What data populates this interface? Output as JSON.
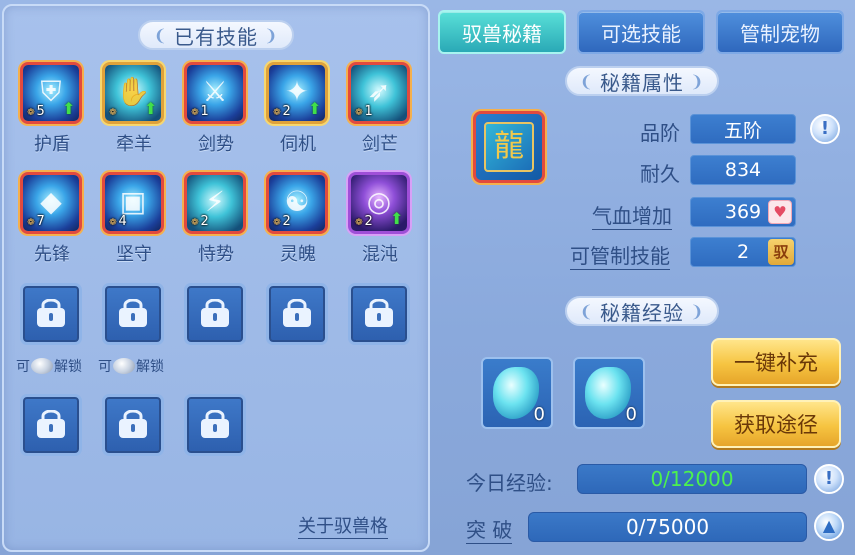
{
  "owned_skills": {
    "title": "已有技能",
    "skills": [
      {
        "name": "护盾",
        "level": "5",
        "upgradable": true,
        "frame": "red",
        "glyph": "⛨"
      },
      {
        "name": "牵羊",
        "level": "",
        "upgradable": true,
        "frame": "gold",
        "glyph": "✋"
      },
      {
        "name": "剑势",
        "level": "1",
        "upgradable": false,
        "frame": "red",
        "glyph": "⚔"
      },
      {
        "name": "伺机",
        "level": "2",
        "upgradable": true,
        "frame": "gold",
        "glyph": "✦"
      },
      {
        "name": "剑芒",
        "level": "1",
        "upgradable": false,
        "frame": "red",
        "glyph": "➶"
      },
      {
        "name": "先锋",
        "level": "7",
        "upgradable": false,
        "frame": "red",
        "glyph": "◆"
      },
      {
        "name": "坚守",
        "level": "4",
        "upgradable": false,
        "frame": "red",
        "glyph": "▣"
      },
      {
        "name": "恃势",
        "level": "2",
        "upgradable": false,
        "frame": "red",
        "glyph": "⚡"
      },
      {
        "name": "灵魄",
        "level": "2",
        "upgradable": false,
        "frame": "red",
        "glyph": "☯"
      },
      {
        "name": "混沌",
        "level": "2",
        "upgradable": true,
        "frame": "purple",
        "glyph": "◎"
      }
    ],
    "unlock_prefix": "可",
    "unlock_suffix": "解锁",
    "about_link": "关于驭兽格"
  },
  "tabs": [
    "驭兽秘籍",
    "可选技能",
    "管制宠物"
  ],
  "active_tab": 0,
  "book_attributes": {
    "title": "秘籍属性",
    "grade_label": "品阶",
    "grade_value": "五阶",
    "durability_label": "耐久",
    "durability_value": "834",
    "hp_bonus_label": "气血增加",
    "hp_bonus_value": "369",
    "control_skill_label": "可管制技能",
    "control_skill_value": "2",
    "control_tag": "驭"
  },
  "book_experience": {
    "title": "秘籍经验",
    "items": [
      {
        "count": "0"
      },
      {
        "count": "0"
      }
    ],
    "refill_button": "一键补充",
    "source_button": "获取途径"
  },
  "progress": {
    "today_label": "今日经验:",
    "today_value": "0/12000",
    "breakthrough_label": "突 破",
    "breakthrough_value": "0/75000"
  },
  "colors": {
    "panel_bg": "#98b5e4",
    "tab_active": "#2aa9b6",
    "tab_inactive": "#2f68bd",
    "gold_button": "#f6c441",
    "today_text": "#4cf14f"
  }
}
